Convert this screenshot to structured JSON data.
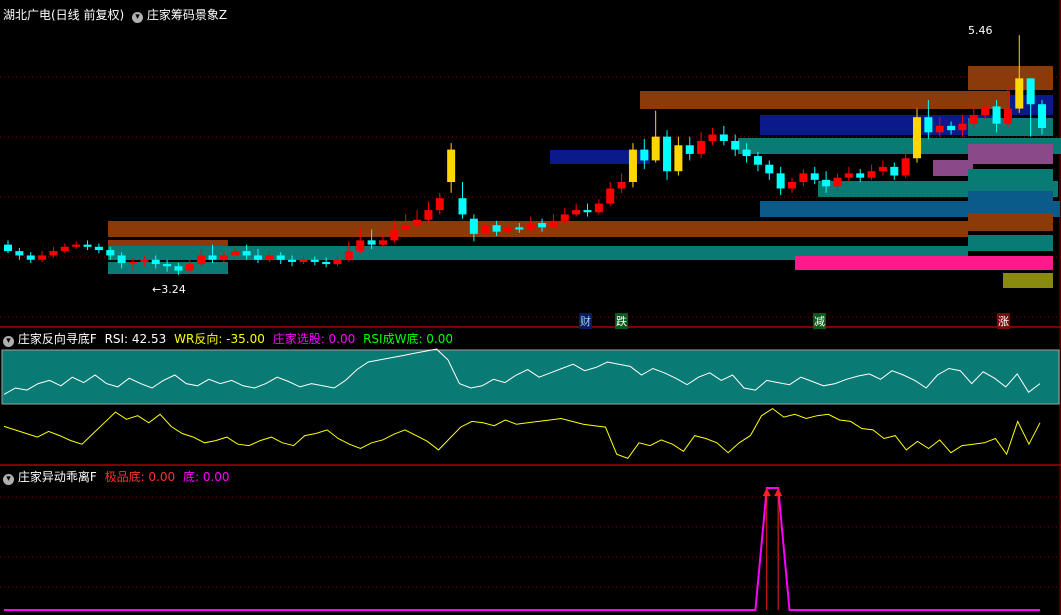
{
  "colors": {
    "bg": "#000000",
    "grid": "#8b0000",
    "separator": "#ff0000",
    "up": "#ff0000",
    "down": "#00ffff",
    "gold": "#ffd700",
    "navy": "#0000aa",
    "teal_panel": "#0a7a74",
    "rsi_line": "#ffffff",
    "wr_line": "#ffff00",
    "magenta": "#ff00ff"
  },
  "panel1": {
    "title": "湖北广电(日线 前复权)",
    "indicator": "庄家筹码景象Z",
    "high_label": "5.46",
    "low_label": "←3.24",
    "tags": [
      "财",
      "跌",
      "减",
      "涨"
    ],
    "bands": [
      {
        "color": "#8b3a0a",
        "label": "brown"
      },
      {
        "color": "#0a7a74",
        "label": "teal"
      },
      {
        "color": "#0a1a8a",
        "label": "navy"
      },
      {
        "color": "#0a5a8a",
        "label": "steel"
      },
      {
        "color": "#8a4a8a",
        "label": "purple"
      },
      {
        "color": "#ff1a8c",
        "label": "pink"
      },
      {
        "color": "#8a8a10",
        "label": "olive"
      }
    ]
  },
  "panel2": {
    "title": "庄家反向寻底F",
    "items": [
      {
        "label": "RSI: 42.53",
        "color": "#ffffff"
      },
      {
        "label": "WR反向: -35.00",
        "color": "#ffff00"
      },
      {
        "label": "庄家选股: 0.00",
        "color": "#ff00ff"
      },
      {
        "label": "RSI成W底: 0.00",
        "color": "#00ff00"
      }
    ]
  },
  "panel3": {
    "title": "庄家异动乖离F",
    "items": [
      {
        "label": "极品底: 0.00",
        "color": "#ff3030"
      },
      {
        "label": "底: 0.00",
        "color": "#ff00ff"
      }
    ]
  },
  "chart_data": [
    {
      "type": "candlestick",
      "title": "湖北广电(日线 前复权)",
      "ylim": [
        3.1,
        5.6
      ],
      "annotations": {
        "max": 5.46,
        "min": 3.24
      },
      "candles": [
        [
          3.52,
          3.46,
          3.56,
          3.44
        ],
        [
          3.46,
          3.42,
          3.49,
          3.38
        ],
        [
          3.42,
          3.38,
          3.45,
          3.35
        ],
        [
          3.38,
          3.42,
          3.46,
          3.36
        ],
        [
          3.42,
          3.46,
          3.5,
          3.4
        ],
        [
          3.46,
          3.5,
          3.53,
          3.44
        ],
        [
          3.5,
          3.52,
          3.55,
          3.48
        ],
        [
          3.52,
          3.5,
          3.56,
          3.47
        ],
        [
          3.5,
          3.47,
          3.53,
          3.44
        ],
        [
          3.47,
          3.42,
          3.5,
          3.38
        ],
        [
          3.42,
          3.35,
          3.45,
          3.3
        ],
        [
          3.35,
          3.36,
          3.4,
          3.28
        ],
        [
          3.36,
          3.38,
          3.42,
          3.32
        ],
        [
          3.38,
          3.34,
          3.42,
          3.3
        ],
        [
          3.34,
          3.32,
          3.38,
          3.27
        ],
        [
          3.32,
          3.28,
          3.35,
          3.24
        ],
        [
          3.28,
          3.34,
          3.38,
          3.26
        ],
        [
          3.34,
          3.42,
          3.48,
          3.32
        ],
        [
          3.42,
          3.38,
          3.52,
          3.35
        ],
        [
          3.38,
          3.42,
          3.46,
          3.35
        ],
        [
          3.42,
          3.46,
          3.5,
          3.4
        ],
        [
          3.46,
          3.42,
          3.52,
          3.38
        ],
        [
          3.42,
          3.38,
          3.48,
          3.35
        ],
        [
          3.38,
          3.42,
          3.46,
          3.36
        ],
        [
          3.42,
          3.38,
          3.45,
          3.34
        ],
        [
          3.38,
          3.36,
          3.42,
          3.32
        ],
        [
          3.36,
          3.38,
          3.42,
          3.34
        ],
        [
          3.38,
          3.36,
          3.41,
          3.33
        ],
        [
          3.36,
          3.34,
          3.4,
          3.31
        ],
        [
          3.34,
          3.38,
          3.42,
          3.32
        ],
        [
          3.38,
          3.46,
          3.55,
          3.36
        ],
        [
          3.46,
          3.56,
          3.68,
          3.44
        ],
        [
          3.56,
          3.52,
          3.66,
          3.48
        ],
        [
          3.52,
          3.56,
          3.62,
          3.5
        ],
        [
          3.56,
          3.66,
          3.74,
          3.54
        ],
        [
          3.66,
          3.7,
          3.8,
          3.62
        ],
        [
          3.7,
          3.75,
          3.84,
          3.68
        ],
        [
          3.75,
          3.84,
          3.92,
          3.72
        ],
        [
          3.84,
          3.95,
          4.0,
          3.8
        ],
        [
          4.1,
          4.4,
          4.46,
          4.0
        ],
        [
          3.95,
          3.8,
          4.1,
          3.76
        ],
        [
          3.76,
          3.62,
          3.8,
          3.55
        ],
        [
          3.62,
          3.7,
          3.74,
          3.6
        ],
        [
          3.7,
          3.64,
          3.74,
          3.6
        ],
        [
          3.64,
          3.68,
          3.72,
          3.62
        ],
        [
          3.68,
          3.66,
          3.72,
          3.63
        ],
        [
          3.66,
          3.72,
          3.78,
          3.64
        ],
        [
          3.72,
          3.68,
          3.76,
          3.64
        ],
        [
          3.68,
          3.74,
          3.8,
          3.66
        ],
        [
          3.74,
          3.8,
          3.86,
          3.72
        ],
        [
          3.8,
          3.84,
          3.9,
          3.78
        ],
        [
          3.84,
          3.82,
          3.9,
          3.78
        ],
        [
          3.82,
          3.9,
          3.94,
          3.8
        ],
        [
          3.9,
          4.04,
          4.1,
          3.88
        ],
        [
          4.04,
          4.1,
          4.18,
          4.0
        ],
        [
          4.1,
          4.4,
          4.46,
          4.05
        ],
        [
          4.4,
          4.3,
          4.5,
          4.22
        ],
        [
          4.3,
          4.52,
          4.76,
          4.28
        ],
        [
          4.52,
          4.2,
          4.58,
          4.12
        ],
        [
          4.2,
          4.44,
          4.52,
          4.16
        ],
        [
          4.44,
          4.36,
          4.52,
          4.3
        ],
        [
          4.36,
          4.48,
          4.56,
          4.32
        ],
        [
          4.48,
          4.54,
          4.6,
          4.44
        ],
        [
          4.54,
          4.48,
          4.62,
          4.44
        ],
        [
          4.48,
          4.4,
          4.54,
          4.34
        ],
        [
          4.4,
          4.34,
          4.46,
          4.28
        ],
        [
          4.34,
          4.26,
          4.38,
          4.2
        ],
        [
          4.26,
          4.18,
          4.3,
          4.12
        ],
        [
          4.18,
          4.04,
          4.24,
          3.98
        ],
        [
          4.04,
          4.1,
          4.14,
          4.0
        ],
        [
          4.1,
          4.18,
          4.22,
          4.06
        ],
        [
          4.18,
          4.12,
          4.24,
          4.08
        ],
        [
          4.12,
          4.06,
          4.2,
          4.0
        ],
        [
          4.06,
          4.14,
          4.18,
          4.02
        ],
        [
          4.14,
          4.18,
          4.24,
          4.1
        ],
        [
          4.18,
          4.14,
          4.22,
          4.1
        ],
        [
          4.14,
          4.2,
          4.26,
          4.12
        ],
        [
          4.2,
          4.24,
          4.3,
          4.16
        ],
        [
          4.24,
          4.16,
          4.28,
          4.12
        ],
        [
          4.16,
          4.32,
          4.4,
          4.14
        ],
        [
          4.32,
          4.7,
          4.78,
          4.28
        ],
        [
          4.7,
          4.56,
          4.86,
          4.5
        ],
        [
          4.56,
          4.62,
          4.7,
          4.52
        ],
        [
          4.62,
          4.58,
          4.66,
          4.54
        ],
        [
          4.58,
          4.64,
          4.72,
          4.52
        ],
        [
          4.64,
          4.72,
          4.8,
          4.6
        ],
        [
          4.72,
          4.8,
          4.86,
          4.68
        ],
        [
          4.8,
          4.64,
          4.86,
          4.56
        ],
        [
          4.64,
          4.78,
          5.0,
          4.6
        ],
        [
          4.78,
          5.06,
          5.46,
          4.74
        ],
        [
          5.06,
          4.82,
          5.06,
          4.52
        ],
        [
          4.82,
          4.6,
          4.86,
          4.54
        ]
      ]
    },
    {
      "type": "line",
      "title": "庄家反向寻底F",
      "series": [
        {
          "name": "RSI",
          "values": [
            42,
            48,
            46,
            52,
            55,
            50,
            58,
            53,
            60,
            52,
            49,
            57,
            52,
            48,
            55,
            60,
            52,
            50,
            56,
            52,
            55,
            50,
            48,
            52,
            58,
            54,
            49,
            52,
            50,
            48,
            55,
            65,
            72,
            74,
            76,
            78,
            80,
            82,
            84,
            74,
            52,
            48,
            50,
            56,
            53,
            60,
            65,
            58,
            62,
            66,
            70,
            64,
            67,
            72,
            70,
            68,
            60,
            66,
            62,
            57,
            51,
            58,
            62,
            55,
            60,
            48,
            46,
            55,
            53,
            51,
            58,
            54,
            50,
            52,
            56,
            59,
            61,
            56,
            64,
            60,
            55,
            48,
            60,
            66,
            64,
            52,
            63,
            57,
            49,
            61,
            44,
            52
          ]
        },
        {
          "name": "WR反向",
          "values": [
            -35,
            -40,
            -45,
            -50,
            -42,
            -48,
            -55,
            -60,
            -45,
            -30,
            -15,
            -25,
            -20,
            -30,
            -18,
            -35,
            -45,
            -50,
            -58,
            -55,
            -50,
            -60,
            -62,
            -55,
            -50,
            -58,
            -62,
            -48,
            -45,
            -40,
            -52,
            -60,
            -66,
            -58,
            -54,
            -46,
            -40,
            -48,
            -56,
            -68,
            -52,
            -36,
            -28,
            -30,
            -34,
            -26,
            -32,
            -30,
            -28,
            -26,
            -24,
            -28,
            -32,
            -34,
            -36,
            -74,
            -80,
            -58,
            -62,
            -54,
            -60,
            -70,
            -48,
            -52,
            -58,
            -72,
            -58,
            -48,
            -20,
            -10,
            -22,
            -18,
            -24,
            -20,
            -18,
            -26,
            -28,
            -38,
            -40,
            -52,
            -48,
            -68,
            -56,
            -66,
            -54,
            -72,
            -62,
            -60,
            -58,
            -52,
            -74,
            -28,
            -60,
            -30
          ]
        }
      ]
    },
    {
      "type": "line",
      "title": "庄家异动乖离F",
      "series": [
        {
          "name": "底",
          "values": [
            0,
            0,
            0,
            0,
            0,
            0,
            0,
            0,
            0,
            0,
            0,
            0,
            0,
            0,
            0,
            0,
            0,
            0,
            0,
            0,
            0,
            0,
            0,
            0,
            0,
            0,
            0,
            0,
            0,
            0,
            0,
            0,
            0,
            0,
            0,
            0,
            0,
            0,
            0,
            0,
            0,
            0,
            0,
            0,
            0,
            0,
            0,
            0,
            0,
            0,
            0,
            0,
            0,
            0,
            0,
            0,
            0,
            0,
            0,
            0,
            0,
            0,
            0,
            0,
            0,
            0,
            0,
            1,
            1,
            0,
            0,
            0,
            0,
            0,
            0,
            0,
            0,
            0,
            0,
            0,
            0,
            0,
            0,
            0,
            0,
            0,
            0,
            0,
            0,
            0,
            0,
            0
          ]
        }
      ]
    }
  ]
}
